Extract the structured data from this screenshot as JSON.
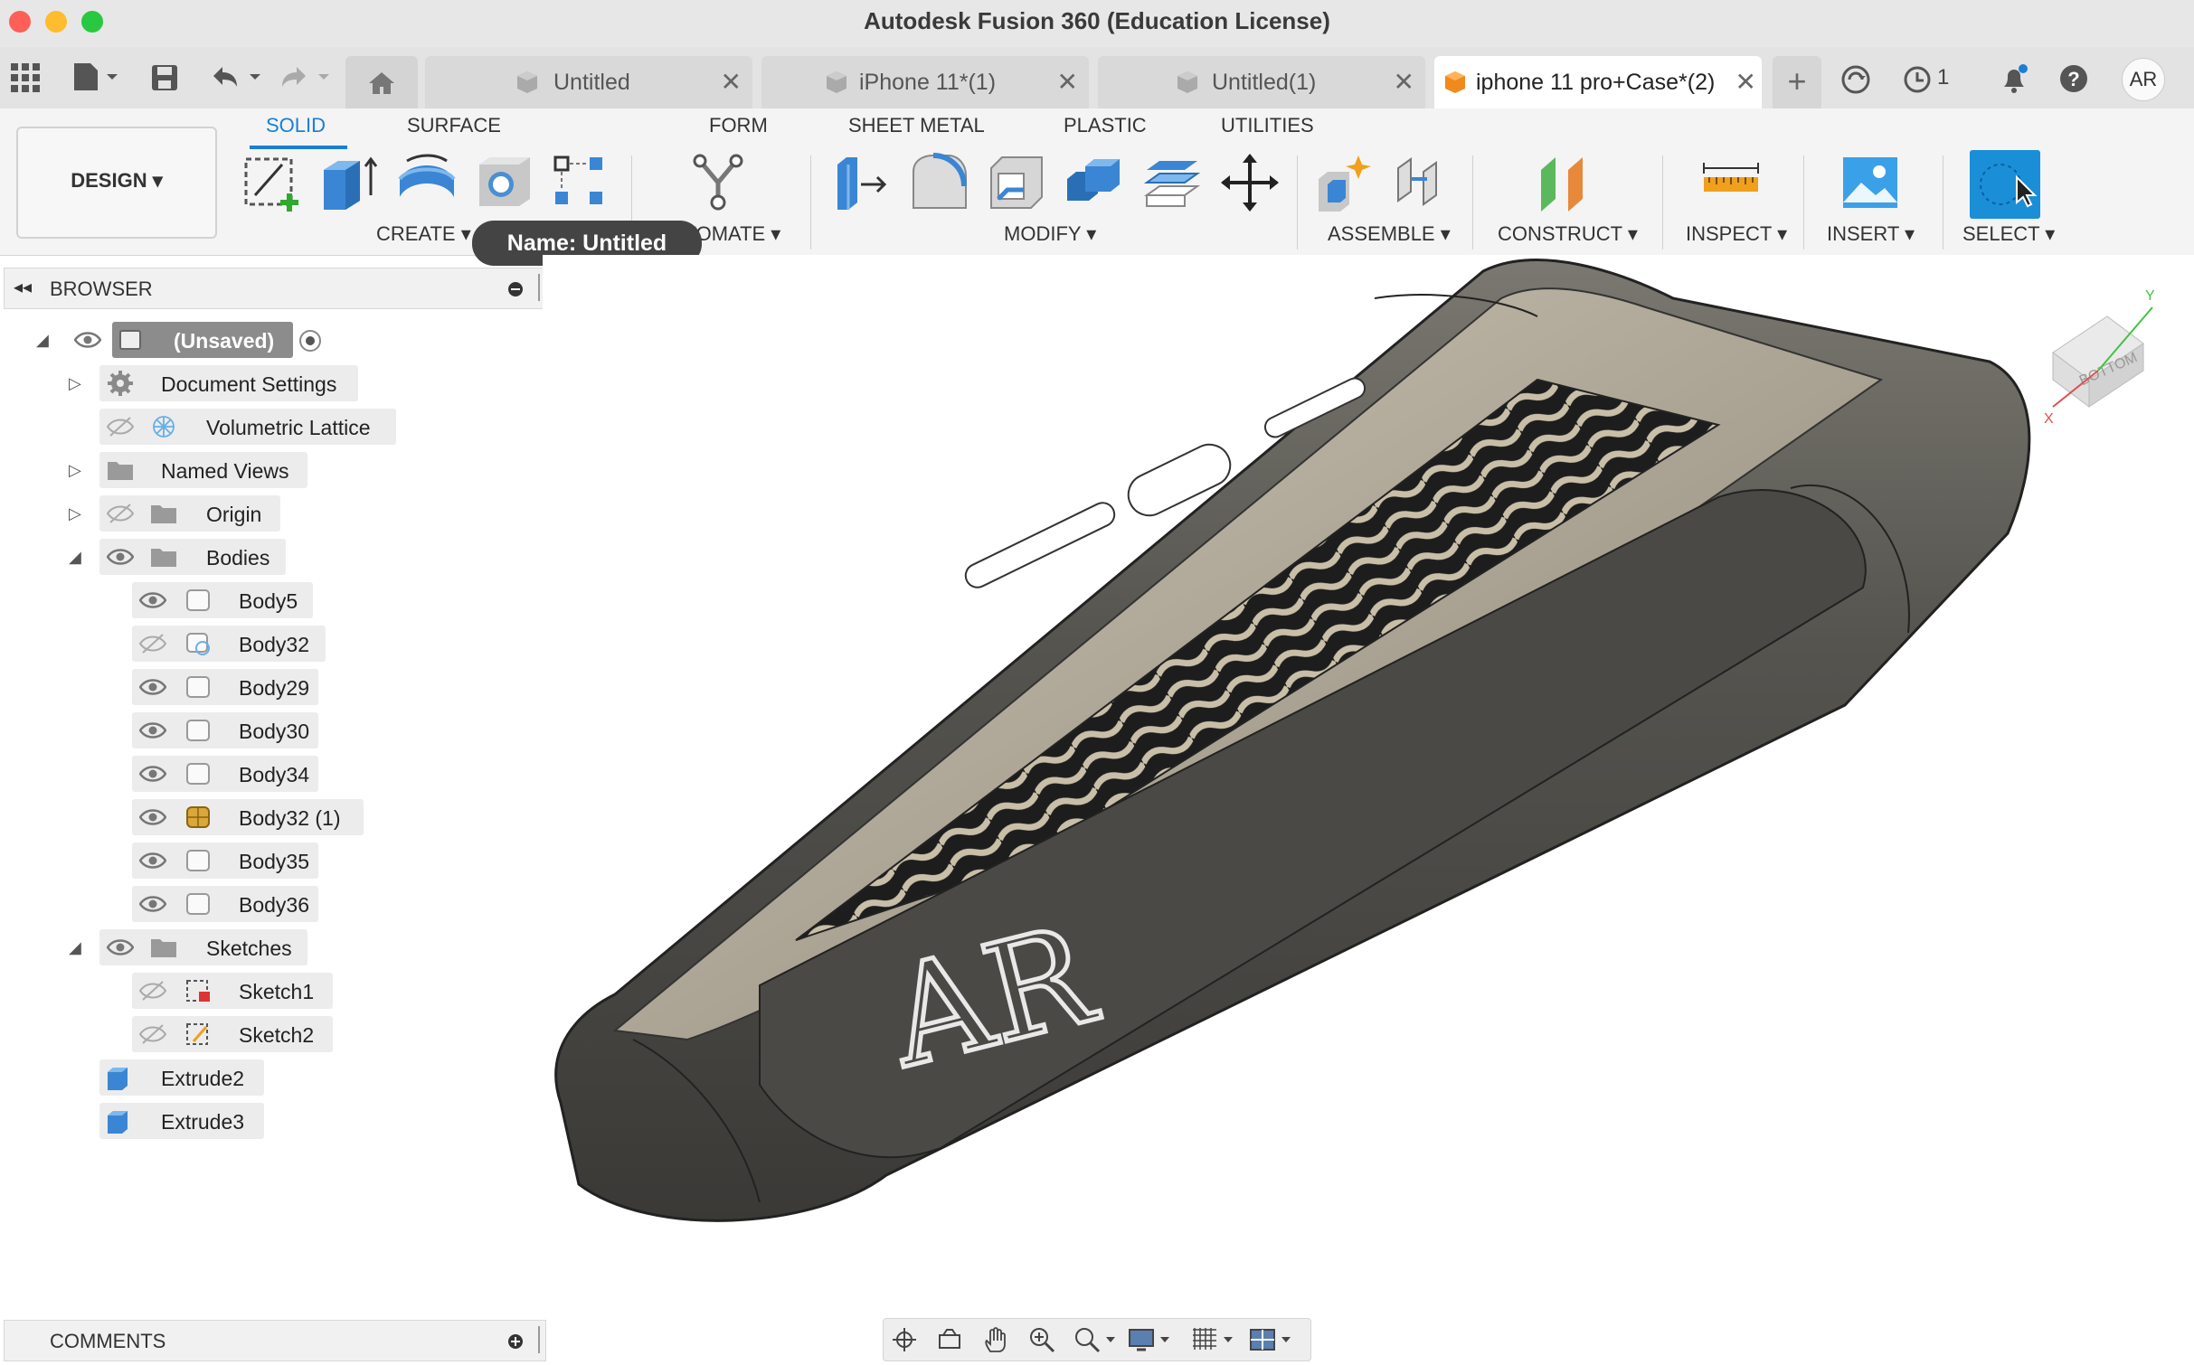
{
  "window": {
    "title": "Autodesk Fusion 360 (Education License)"
  },
  "tabs": [
    {
      "label": "Untitled",
      "close": "✕"
    },
    {
      "label": "iPhone 11*(1)",
      "close": "✕"
    },
    {
      "label": "Untitled(1)",
      "close": "✕"
    },
    {
      "label": "iphone 11 pro+Case*(2)",
      "close": "✕"
    }
  ],
  "topbar": {
    "job_count": "1",
    "user_initials": "AR"
  },
  "workspace": {
    "label": "DESIGN ▾"
  },
  "ribbon_tabs": [
    "SOLID",
    "SURFACE",
    "FORM",
    "SHEET METAL",
    "PLASTIC",
    "UTILITIES"
  ],
  "tooltip": "Name: Untitled",
  "ribbon_groups": {
    "create": "CREATE ▾",
    "automate": "AUTOMATE ▾",
    "modify": "MODIFY ▾",
    "assemble": "ASSEMBLE ▾",
    "construct": "CONSTRUCT ▾",
    "inspect": "INSPECT ▾",
    "insert": "INSERT ▾",
    "select": "SELECT ▾"
  },
  "browser": {
    "title": "BROWSER",
    "root": "(Unsaved)",
    "items": [
      {
        "label": "Document Settings"
      },
      {
        "label": "Volumetric Lattice"
      },
      {
        "label": "Named Views"
      },
      {
        "label": "Origin"
      },
      {
        "label": "Bodies"
      },
      {
        "label": "Body5"
      },
      {
        "label": "Body32"
      },
      {
        "label": "Body29"
      },
      {
        "label": "Body30"
      },
      {
        "label": "Body34"
      },
      {
        "label": "Body32 (1)"
      },
      {
        "label": "Body35"
      },
      {
        "label": "Body36"
      },
      {
        "label": "Sketches"
      },
      {
        "label": "Sketch1"
      },
      {
        "label": "Sketch2"
      },
      {
        "label": "Extrude2"
      },
      {
        "label": "Extrude3"
      }
    ]
  },
  "comments": {
    "title": "COMMENTS"
  },
  "viewcube": {
    "face": "BOTTOM",
    "x": "X",
    "y": "Y"
  },
  "model": {
    "engraving": "AR"
  }
}
